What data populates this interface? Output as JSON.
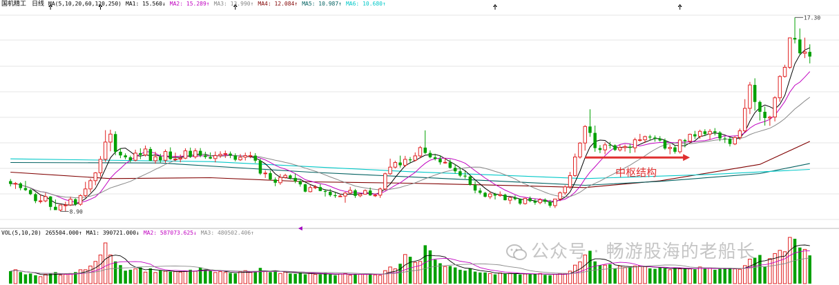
{
  "header": {
    "stock_name": "国机精工",
    "period": "日线",
    "ma_params": "MA(5,10,20,60,120,250)",
    "ma_values": [
      {
        "label": "MA1: 15.560↓",
        "color": "#000000"
      },
      {
        "label": "MA2: 15.289↑",
        "color": "#c000c0"
      },
      {
        "label": "MA3: 13.990↑",
        "color": "#888888"
      },
      {
        "label": "MA4: 12.084↑",
        "color": "#800000"
      },
      {
        "label": "MA5: 10.987↑",
        "color": "#006060"
      },
      {
        "label": "MA6: 10.680↑",
        "color": "#00c8c8"
      }
    ]
  },
  "volume_header": {
    "params": "VOL(5,10,20)",
    "vol_value": "265504.000↑",
    "items": [
      {
        "label": "MA1: 390721.000↓",
        "color": "#000000"
      },
      {
        "label": "MA2: 587073.625↓",
        "color": "#c000c0"
      },
      {
        "label": "MA3: 480502.406↑",
        "color": "#888888"
      }
    ]
  },
  "annotation": {
    "text": "中枢结构",
    "color": "#e03030"
  },
  "watermark": {
    "text": "公众号 · 畅游股海的老船长",
    "icon": "wechat-icon"
  },
  "chart_data": {
    "type": "candlestick",
    "ylim": [
      8.2,
      17.7
    ],
    "grid": true,
    "up_color": "#e02020",
    "down_color": "#00a000",
    "high_label": "17.30",
    "low_label": "8.90",
    "x_range": [
      -1,
      161
    ],
    "marker_ticks": [
      8,
      18,
      45,
      97,
      134
    ],
    "opens": [
      10.17,
      10.05,
      10.07,
      9.87,
      9.78,
      9.6,
      9.3,
      9.31,
      9.5,
      9.05,
      8.91,
      9.13,
      9.13,
      9.38,
      9.16,
      9.54,
      9.83,
      10.19,
      10.53,
      11.12,
      11.87,
      12.22,
      11.45,
      11.29,
      11.21,
      11.08,
      11.39,
      11.31,
      11.57,
      11.06,
      11.23,
      11.08,
      11.46,
      11.13,
      11.13,
      11.17,
      11.49,
      11.23,
      11.49,
      11.29,
      11.22,
      11.15,
      11.28,
      11.34,
      11.37,
      11.29,
      11.1,
      11.21,
      11.28,
      11.28,
      11.06,
      10.5,
      10.52,
      10.24,
      10.1,
      10.33,
      10.42,
      10.31,
      10.17,
      10.03,
      9.71,
      9.89,
      9.91,
      9.74,
      9.7,
      9.56,
      9.52,
      9.52,
      9.65,
      9.77,
      9.53,
      9.6,
      9.76,
      9.55,
      9.56,
      9.83,
      10.49,
      10.78,
      10.98,
      10.86,
      11.12,
      11.08,
      11.27,
      11.63,
      11.4,
      11.21,
      11.14,
      10.99,
      10.99,
      10.75,
      10.6,
      10.41,
      10.37,
      10.01,
      9.76,
      9.66,
      9.49,
      9.61,
      9.54,
      9.58,
      9.34,
      9.45,
      9.38,
      9.19,
      9.42,
      9.3,
      9.23,
      9.36,
      9.27,
      9.1,
      9.39,
      9.66,
      9.92,
      10.41,
      11.22,
      11.83,
      12.55,
      12.27,
      11.61,
      11.53,
      11.75,
      11.73,
      11.53,
      11.63,
      11.67,
      11.62,
      11.97,
      11.97,
      12.11,
      12.07,
      12.02,
      11.94,
      11.59,
      11.64,
      11.45,
      11.96,
      11.91,
      12.21,
      12.12,
      12.34,
      12.22,
      12.34,
      12.29,
      12.03,
      12.01,
      11.79,
      12.07,
      12.36,
      13.34,
      14.36,
      13.62,
      13.19,
      12.92,
      12.96,
      13.8,
      14.73,
      15.13,
      16.41,
      16.34,
      15.74,
      15.8
    ],
    "highs": [
      10.26,
      10.13,
      10.12,
      10.18,
      9.84,
      9.66,
      9.58,
      9.66,
      9.52,
      9.37,
      9.14,
      9.27,
      9.49,
      9.42,
      9.59,
      10.14,
      10.28,
      10.56,
      11.26,
      12.39,
      12.41,
      12.34,
      11.6,
      11.38,
      11.28,
      11.54,
      11.6,
      11.72,
      11.66,
      11.45,
      11.36,
      11.55,
      11.64,
      11.41,
      11.33,
      11.6,
      11.63,
      11.6,
      11.61,
      11.45,
      11.42,
      11.46,
      11.47,
      11.5,
      11.46,
      11.38,
      11.35,
      11.41,
      11.45,
      11.39,
      11.15,
      10.64,
      10.62,
      10.33,
      10.48,
      10.49,
      10.46,
      10.5,
      10.22,
      10.06,
      9.99,
      10.0,
      10.04,
      9.82,
      9.83,
      9.71,
      9.61,
      9.7,
      9.92,
      9.83,
      9.66,
      9.81,
      9.89,
      9.63,
      9.89,
      10.54,
      11.15,
      11.06,
      11.28,
      11.27,
      11.22,
      11.42,
      11.7,
      12.38,
      11.51,
      11.36,
      11.29,
      11.18,
      11.12,
      10.91,
      10.77,
      10.61,
      10.43,
      10.17,
      9.87,
      9.7,
      9.72,
      9.66,
      9.72,
      9.62,
      9.48,
      9.55,
      9.42,
      9.44,
      9.5,
      9.41,
      9.43,
      9.42,
      9.35,
      9.4,
      9.72,
      9.99,
      10.57,
      11.37,
      11.87,
      12.61,
      13.3,
      12.59,
      11.74,
      11.86,
      11.88,
      11.77,
      11.75,
      11.76,
      11.79,
      12.06,
      12.23,
      12.15,
      12.19,
      12.16,
      12.13,
      12.03,
      11.77,
      11.73,
      12.0,
      12.01,
      12.24,
      12.36,
      12.41,
      12.43,
      12.44,
      12.48,
      12.35,
      12.12,
      12.08,
      12.13,
      12.46,
      13.74,
      14.49,
      14.65,
      13.68,
      13.42,
      13.02,
      13.87,
      14.78,
      15.24,
      16.42,
      17.3,
      16.82,
      16.42,
      16.13
    ],
    "lows": [
      9.94,
      9.83,
      9.77,
      9.74,
      9.56,
      9.21,
      9.2,
      9.25,
      8.9,
      8.98,
      8.85,
      8.86,
      9.09,
      9.09,
      9.1,
      9.46,
      9.68,
      9.99,
      10.36,
      11.01,
      11.47,
      11.3,
      11.17,
      11.12,
      10.99,
      11.03,
      11.13,
      11.24,
      11.05,
      10.93,
      10.98,
      10.97,
      11.1,
      11.03,
      10.99,
      11.13,
      11.18,
      11.15,
      11.21,
      11.14,
      11.13,
      10.99,
      11.18,
      11.18,
      11.17,
      11.03,
      11.05,
      11.07,
      11.17,
      10.96,
      10.44,
      10.31,
      10.2,
      9.95,
      10.01,
      10.28,
      10.24,
      10.08,
      9.93,
      9.68,
      9.68,
      9.82,
      9.73,
      9.5,
      9.49,
      9.44,
      9.49,
      9.23,
      9.62,
      9.44,
      9.47,
      9.58,
      9.53,
      9.48,
      9.44,
      9.76,
      10.44,
      10.72,
      10.76,
      10.78,
      10.98,
      11.03,
      11.16,
      11.35,
      11.16,
      11.07,
      10.89,
      10.93,
      10.71,
      10.5,
      10.34,
      10.28,
      9.97,
      9.64,
      9.59,
      9.46,
      9.39,
      9.37,
      9.49,
      9.33,
      9.17,
      9.33,
      9.13,
      9.15,
      9.25,
      9.14,
      9.16,
      9.18,
      9.02,
      9.0,
      9.3,
      9.57,
      9.83,
      10.36,
      11.15,
      11.5,
      12.1,
      11.45,
      11.39,
      11.34,
      11.59,
      11.48,
      11.46,
      11.46,
      11.39,
      11.42,
      11.89,
      11.83,
      11.93,
      11.89,
      11.89,
      11.53,
      11.34,
      11.37,
      11.37,
      11.64,
      11.82,
      12.01,
      12.02,
      12.13,
      11.97,
      12.16,
      11.91,
      11.83,
      11.68,
      11.74,
      11.97,
      12.29,
      13.09,
      13.24,
      12.81,
      12.59,
      12.58,
      12.77,
      13.63,
      14.68,
      15.06,
      16.17,
      15.66,
      15.53,
      15.3
    ],
    "closes": [
      10.05,
      10.07,
      9.87,
      9.78,
      9.6,
      9.3,
      9.31,
      9.5,
      9.05,
      8.91,
      9.13,
      9.13,
      9.38,
      9.16,
      9.54,
      9.83,
      10.19,
      10.53,
      11.12,
      11.87,
      12.22,
      11.45,
      11.29,
      11.21,
      11.08,
      11.39,
      11.31,
      11.57,
      11.06,
      11.23,
      11.08,
      11.46,
      11.13,
      11.13,
      11.17,
      11.49,
      11.23,
      11.49,
      11.29,
      11.22,
      11.15,
      11.28,
      11.34,
      11.37,
      11.29,
      11.1,
      11.21,
      11.28,
      11.28,
      11.06,
      10.5,
      10.52,
      10.24,
      10.1,
      10.33,
      10.42,
      10.31,
      10.17,
      10.03,
      9.71,
      9.89,
      9.91,
      9.74,
      9.7,
      9.56,
      9.52,
      9.52,
      9.65,
      9.77,
      9.53,
      9.6,
      9.76,
      9.55,
      9.56,
      9.83,
      10.49,
      10.78,
      10.98,
      10.86,
      11.12,
      11.08,
      11.27,
      11.63,
      11.4,
      11.21,
      11.14,
      10.99,
      10.99,
      10.75,
      10.6,
      10.41,
      10.37,
      10.01,
      9.76,
      9.66,
      9.49,
      9.61,
      9.54,
      9.58,
      9.34,
      9.45,
      9.38,
      9.19,
      9.42,
      9.3,
      9.23,
      9.36,
      9.27,
      9.1,
      9.39,
      9.66,
      9.92,
      10.41,
      11.22,
      11.83,
      12.55,
      12.27,
      11.61,
      11.53,
      11.75,
      11.73,
      11.53,
      11.63,
      11.67,
      11.62,
      11.97,
      11.97,
      12.11,
      12.07,
      12.02,
      11.94,
      11.59,
      11.64,
      11.45,
      11.96,
      11.91,
      12.21,
      12.12,
      12.34,
      12.22,
      12.34,
      12.29,
      12.03,
      12.01,
      11.79,
      12.07,
      12.36,
      13.34,
      14.36,
      13.62,
      13.19,
      12.92,
      12.96,
      13.8,
      14.73,
      15.13,
      16.41,
      16.34,
      15.74,
      15.8,
      15.6
    ],
    "volumes": [
      0.27,
      0.3,
      0.25,
      0.2,
      0.22,
      0.18,
      0.15,
      0.2,
      0.22,
      0.25,
      0.18,
      0.2,
      0.22,
      0.25,
      0.3,
      0.3,
      0.38,
      0.48,
      0.62,
      0.88,
      0.62,
      0.48,
      0.4,
      0.28,
      0.3,
      0.32,
      0.35,
      0.25,
      0.33,
      0.24,
      0.28,
      0.27,
      0.26,
      0.26,
      0.25,
      0.27,
      0.3,
      0.27,
      0.35,
      0.3,
      0.28,
      0.24,
      0.26,
      0.24,
      0.23,
      0.22,
      0.26,
      0.28,
      0.24,
      0.27,
      0.34,
      0.26,
      0.25,
      0.28,
      0.22,
      0.25,
      0.22,
      0.21,
      0.24,
      0.2,
      0.22,
      0.2,
      0.2,
      0.23,
      0.2,
      0.18,
      0.21,
      0.22,
      0.18,
      0.21,
      0.2,
      0.2,
      0.22,
      0.19,
      0.18,
      0.28,
      0.36,
      0.32,
      0.43,
      0.63,
      0.58,
      0.46,
      0.48,
      0.83,
      0.72,
      0.52,
      0.44,
      0.37,
      0.38,
      0.35,
      0.3,
      0.28,
      0.33,
      0.26,
      0.24,
      0.24,
      0.22,
      0.2,
      0.23,
      0.21,
      0.22,
      0.22,
      0.2,
      0.21,
      0.2,
      0.21,
      0.22,
      0.19,
      0.18,
      0.2,
      0.22,
      0.22,
      0.27,
      0.4,
      0.47,
      0.62,
      0.71,
      0.48,
      0.4,
      0.4,
      0.42,
      0.33,
      0.38,
      0.35,
      0.36,
      0.38,
      0.38,
      0.37,
      0.33,
      0.32,
      0.35,
      0.33,
      0.3,
      0.34,
      0.32,
      0.33,
      0.32,
      0.31,
      0.36,
      0.33,
      0.34,
      0.3,
      0.32,
      0.33,
      0.34,
      0.32,
      0.31,
      0.39,
      0.53,
      0.56,
      0.62,
      0.37,
      0.54,
      0.65,
      0.72,
      0.69,
      1.0,
      0.97,
      0.78,
      0.74,
      0.61
    ],
    "ma_lines": [
      {
        "name": "MA1",
        "period": 5,
        "color": "#000000",
        "width": 1.0
      },
      {
        "name": "MA2",
        "period": 10,
        "color": "#c000c0",
        "width": 1.0
      },
      {
        "name": "MA3",
        "period": 20,
        "color": "#888888",
        "width": 1.0
      }
    ],
    "long_ma_lines": [
      {
        "name": "MA4",
        "color": "#800000",
        "points": [
          [
            0,
            10.56
          ],
          [
            20,
            10.28
          ],
          [
            40,
            10.32
          ],
          [
            60,
            10.14
          ],
          [
            80,
            10.08
          ],
          [
            100,
            9.98
          ],
          [
            115,
            9.89
          ],
          [
            130,
            10.18
          ],
          [
            150,
            10.9
          ],
          [
            160,
            11.9
          ]
        ]
      },
      {
        "name": "MA5",
        "color": "#006060",
        "points": [
          [
            0,
            10.98
          ],
          [
            30,
            10.96
          ],
          [
            60,
            10.56
          ],
          [
            90,
            10.25
          ],
          [
            115,
            9.99
          ],
          [
            130,
            10.16
          ],
          [
            150,
            10.5
          ],
          [
            160,
            10.94
          ]
        ]
      },
      {
        "name": "MA6",
        "color": "#00c8c8",
        "points": [
          [
            0,
            11.14
          ],
          [
            40,
            11.02
          ],
          [
            80,
            10.58
          ],
          [
            115,
            10.28
          ],
          [
            140,
            10.46
          ],
          [
            160,
            10.68
          ]
        ]
      }
    ],
    "arrow": {
      "x1": 115,
      "x2": 136,
      "y": 11.2
    }
  }
}
